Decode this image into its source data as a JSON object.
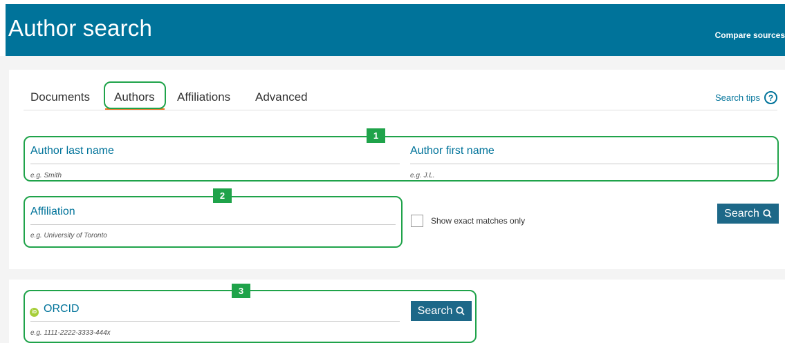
{
  "header": {
    "title": "Author search",
    "compare_sources": "Compare sources"
  },
  "tabs": [
    {
      "label": "Documents",
      "active": false
    },
    {
      "label": "Authors",
      "active": true
    },
    {
      "label": "Affiliations",
      "active": false
    },
    {
      "label": "Advanced",
      "active": false
    }
  ],
  "search_tips": {
    "label": "Search tips",
    "icon": "help-icon"
  },
  "form": {
    "last_name": {
      "label": "Author last name",
      "placeholder": "e.g. Smith"
    },
    "first_name": {
      "label": "Author first name",
      "placeholder": "e.g. J.L."
    },
    "affiliation": {
      "label": "Affiliation",
      "placeholder": "e.g. University of Toronto"
    },
    "exact_matches": {
      "label": "Show exact matches only",
      "checked": false
    },
    "search_button": "Search"
  },
  "orcid": {
    "label": "ORCID",
    "placeholder": "e.g. 1111-2222-3333-444x",
    "search_button": "Search"
  },
  "annotations": [
    {
      "number": "1"
    },
    {
      "number": "2"
    },
    {
      "number": "3"
    }
  ],
  "colors": {
    "header_bg": "#00739a",
    "link": "#00739a",
    "button_bg": "#1d6888",
    "highlight": "#1fa34a",
    "tab_underline": "#e9711c",
    "orcid_green": "#a6ce39"
  }
}
